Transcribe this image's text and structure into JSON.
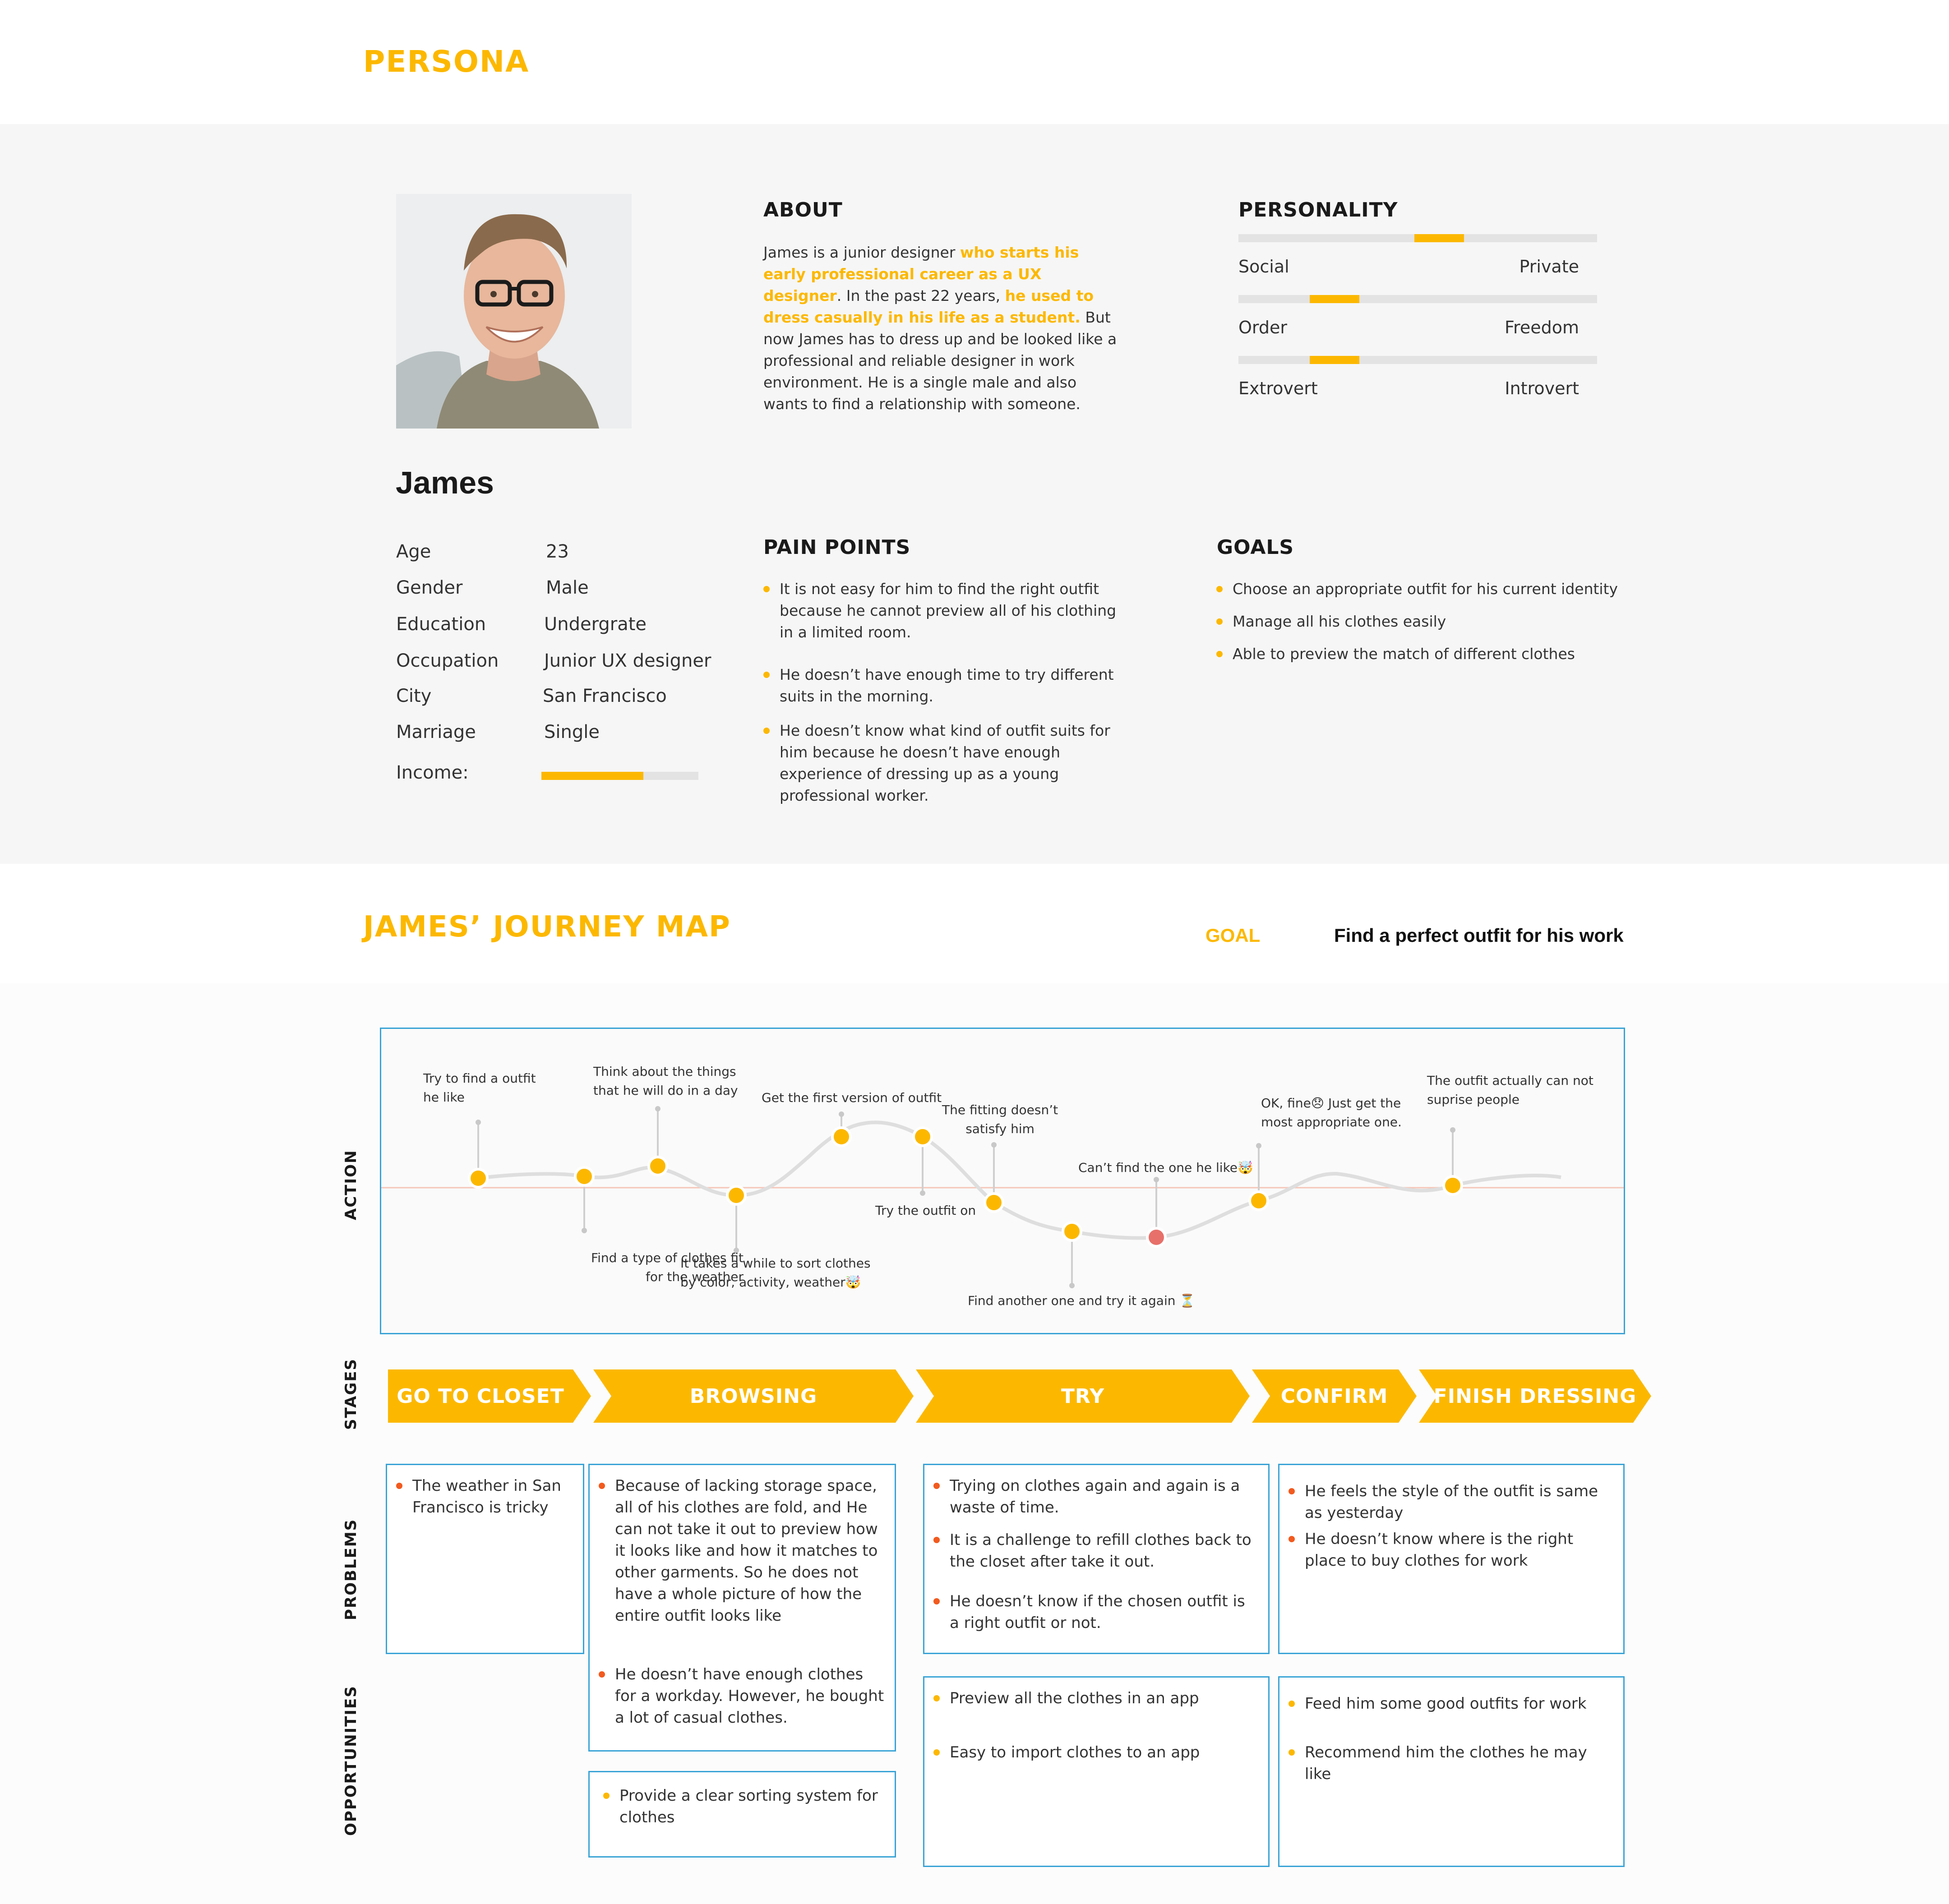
{
  "persona": {
    "section_title": "PERSONA",
    "name": "James",
    "about": {
      "title": "ABOUT",
      "p1": "James is a junior designer ",
      "h1": "who starts his early professional career as a UX designer",
      "p2": ". In the past 22 years, ",
      "h2": "he used to dress casually in his life as a student.",
      "p3": " But now James has to dress up and be looked like a professional and reliable designer in work environment. He is a single male and also wants to find a relationship with someone."
    },
    "personality": {
      "title": "PERSONALITY",
      "traits": [
        {
          "left": "Social",
          "right": "Private",
          "level": 0.57
        },
        {
          "left": "Order",
          "right": "Freedom",
          "level": 0.23
        },
        {
          "left": "Extrovert",
          "right": "Introvert",
          "level": 0.23
        }
      ]
    },
    "demographics": [
      {
        "label": "Age",
        "value": "23"
      },
      {
        "label": "Gender",
        "value": "Male"
      },
      {
        "label": "Education",
        "value": "Undergrate"
      },
      {
        "label": "Occupation",
        "value": "Junior UX designer"
      },
      {
        "label": "City",
        "value": "San Francisco"
      },
      {
        "label": "Marriage",
        "value": "Single"
      }
    ],
    "income": {
      "label": "Income:",
      "level": 0.65
    },
    "pain_points": {
      "title": "PAIN POINTS",
      "items": [
        "It is not easy for him to find the right outfit because he cannot preview all of his clothing in a limited room.",
        "He doesn’t have enough time to try different suits in the morning.",
        "He doesn’t know what kind of outfit suits for him because he doesn’t have enough experience of dressing up as a young professional worker."
      ]
    },
    "goals": {
      "title": "GOALS",
      "items": [
        "Choose an appropriate outfit for his current identity",
        "Manage all his clothes easily",
        "Able to preview the match of different clothes"
      ]
    }
  },
  "journey": {
    "title": "JAMES’ JOURNEY MAP",
    "goal_label": "GOAL",
    "goal_text": "Find a perfect outfit for his work",
    "row_labels": {
      "action": "ACTION",
      "stages": "STAGES",
      "problems": "PROBLEMS",
      "opportunities": "OPPORTUNITIES"
    },
    "points": [
      "Try to find a outfit\nhe like",
      "Find a type of clothes fit\nfor the weather",
      "Think about the things\nthat he will do in a day",
      "It takes a while to sort clothes\nby color, activity, weather🤯",
      "Get the first version of outfit",
      "Try the outfit on",
      "The fitting doesn’t\nsatisfy him",
      "Find another one and try it again ⏳",
      "Can’t find the one he like🤯",
      "OK, fine😞 Just get the\nmost appropriate one.",
      "The outfit actually can not\nsuprise people"
    ],
    "stages": [
      "GO TO CLOSET",
      "BROWSING",
      "TRY",
      "CONFIRM",
      "FINISH DRESSING"
    ],
    "problems": {
      "closet": [
        "The weather in San Francisco is tricky"
      ],
      "browsing": [
        "Because of lacking storage space, all of his clothes are fold, and He can not take it out to preview how it looks like and how it matches to other garments. So he does not have a whole picture of how the entire outfit looks like",
        "He doesn’t have enough clothes for a workday. However, he bought a lot of casual clothes."
      ],
      "try": [
        "Trying on clothes again and again is a waste of time.",
        "It is a challenge to refill clothes back to the closet after take it out.",
        "He doesn’t know if the chosen outfit is a right outfit or not."
      ],
      "confirm": [
        "He feels the style of the outfit is same as yesterday",
        "He doesn’t know where is the right place to buy clothes for work"
      ]
    },
    "opportunities": {
      "browsing": [
        "Provide a clear sorting system for clothes"
      ],
      "try": [
        "Preview all the clothes in an app",
        "Easy to import clothes to an app"
      ],
      "confirm": [
        "Feed him some good outfits for work",
        "Recommend him the clothes he may like"
      ]
    }
  },
  "colors": {
    "accent": "#FCB800",
    "frame": "#39A3D6",
    "problem_bullet": "#F25A1E",
    "low_point": "#E8706A"
  }
}
